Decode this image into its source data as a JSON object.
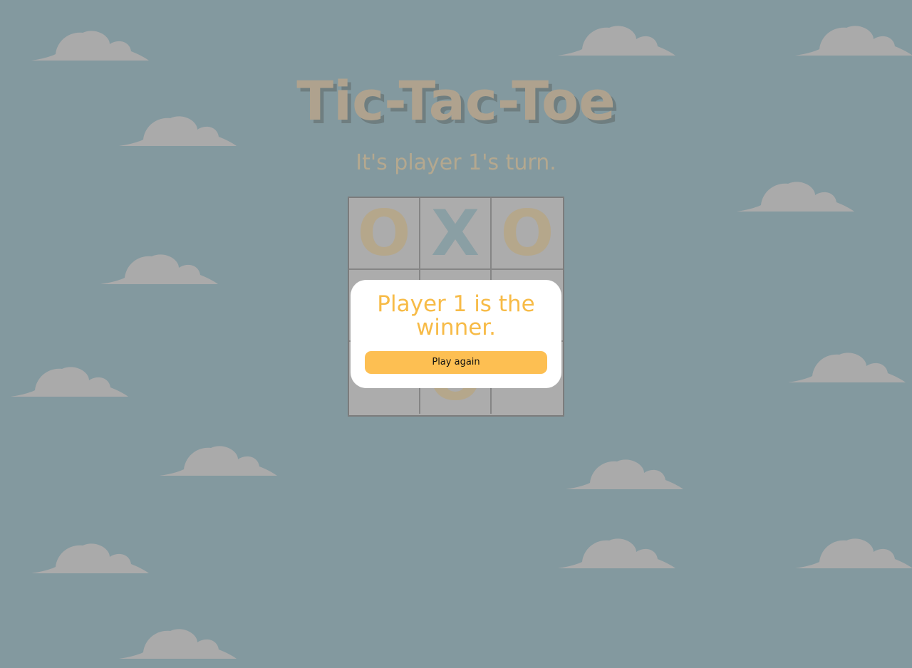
{
  "game": {
    "title": "Tic-Tac-Toe",
    "status": "It's player 1's turn."
  },
  "board": {
    "cells": [
      "O",
      "X",
      "O",
      "",
      "",
      "",
      "",
      "O",
      ""
    ]
  },
  "modal": {
    "message": "Player 1 is the winner.",
    "button_label": "Play again"
  },
  "colors": {
    "background": "#83999f",
    "cloud": "#aaaaaa",
    "o_mark": "#b5a78b",
    "x_mark": "#8a9fa4",
    "accent": "#f7bb47",
    "button": "#fdbf52"
  },
  "icons": {
    "decoration": "cloud-icon"
  }
}
